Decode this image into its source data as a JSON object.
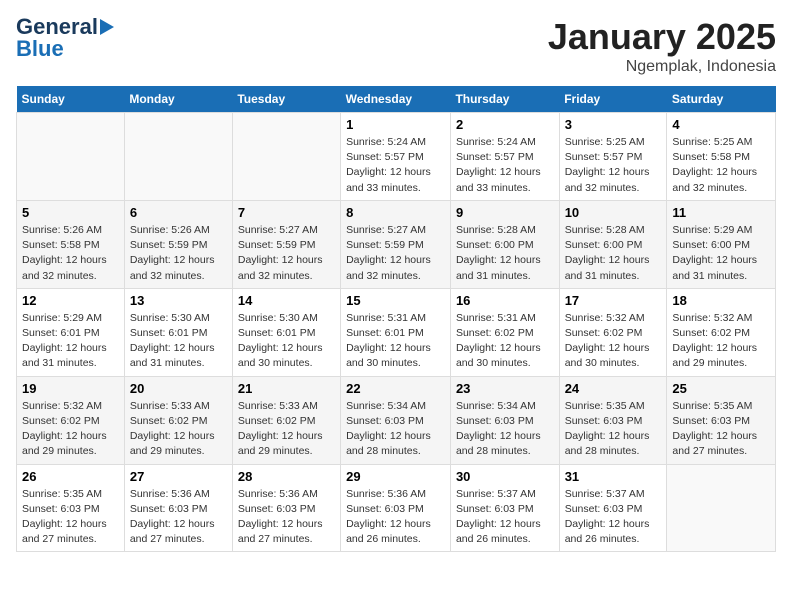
{
  "header": {
    "logo_line1": "General",
    "logo_line2": "Blue",
    "title": "January 2025",
    "subtitle": "Ngemplak, Indonesia"
  },
  "weekdays": [
    "Sunday",
    "Monday",
    "Tuesday",
    "Wednesday",
    "Thursday",
    "Friday",
    "Saturday"
  ],
  "weeks": [
    [
      {
        "day": "",
        "info": ""
      },
      {
        "day": "",
        "info": ""
      },
      {
        "day": "",
        "info": ""
      },
      {
        "day": "1",
        "info": "Sunrise: 5:24 AM\nSunset: 5:57 PM\nDaylight: 12 hours and 33 minutes."
      },
      {
        "day": "2",
        "info": "Sunrise: 5:24 AM\nSunset: 5:57 PM\nDaylight: 12 hours and 33 minutes."
      },
      {
        "day": "3",
        "info": "Sunrise: 5:25 AM\nSunset: 5:57 PM\nDaylight: 12 hours and 32 minutes."
      },
      {
        "day": "4",
        "info": "Sunrise: 5:25 AM\nSunset: 5:58 PM\nDaylight: 12 hours and 32 minutes."
      }
    ],
    [
      {
        "day": "5",
        "info": "Sunrise: 5:26 AM\nSunset: 5:58 PM\nDaylight: 12 hours and 32 minutes."
      },
      {
        "day": "6",
        "info": "Sunrise: 5:26 AM\nSunset: 5:59 PM\nDaylight: 12 hours and 32 minutes."
      },
      {
        "day": "7",
        "info": "Sunrise: 5:27 AM\nSunset: 5:59 PM\nDaylight: 12 hours and 32 minutes."
      },
      {
        "day": "8",
        "info": "Sunrise: 5:27 AM\nSunset: 5:59 PM\nDaylight: 12 hours and 32 minutes."
      },
      {
        "day": "9",
        "info": "Sunrise: 5:28 AM\nSunset: 6:00 PM\nDaylight: 12 hours and 31 minutes."
      },
      {
        "day": "10",
        "info": "Sunrise: 5:28 AM\nSunset: 6:00 PM\nDaylight: 12 hours and 31 minutes."
      },
      {
        "day": "11",
        "info": "Sunrise: 5:29 AM\nSunset: 6:00 PM\nDaylight: 12 hours and 31 minutes."
      }
    ],
    [
      {
        "day": "12",
        "info": "Sunrise: 5:29 AM\nSunset: 6:01 PM\nDaylight: 12 hours and 31 minutes."
      },
      {
        "day": "13",
        "info": "Sunrise: 5:30 AM\nSunset: 6:01 PM\nDaylight: 12 hours and 31 minutes."
      },
      {
        "day": "14",
        "info": "Sunrise: 5:30 AM\nSunset: 6:01 PM\nDaylight: 12 hours and 30 minutes."
      },
      {
        "day": "15",
        "info": "Sunrise: 5:31 AM\nSunset: 6:01 PM\nDaylight: 12 hours and 30 minutes."
      },
      {
        "day": "16",
        "info": "Sunrise: 5:31 AM\nSunset: 6:02 PM\nDaylight: 12 hours and 30 minutes."
      },
      {
        "day": "17",
        "info": "Sunrise: 5:32 AM\nSunset: 6:02 PM\nDaylight: 12 hours and 30 minutes."
      },
      {
        "day": "18",
        "info": "Sunrise: 5:32 AM\nSunset: 6:02 PM\nDaylight: 12 hours and 29 minutes."
      }
    ],
    [
      {
        "day": "19",
        "info": "Sunrise: 5:32 AM\nSunset: 6:02 PM\nDaylight: 12 hours and 29 minutes."
      },
      {
        "day": "20",
        "info": "Sunrise: 5:33 AM\nSunset: 6:02 PM\nDaylight: 12 hours and 29 minutes."
      },
      {
        "day": "21",
        "info": "Sunrise: 5:33 AM\nSunset: 6:02 PM\nDaylight: 12 hours and 29 minutes."
      },
      {
        "day": "22",
        "info": "Sunrise: 5:34 AM\nSunset: 6:03 PM\nDaylight: 12 hours and 28 minutes."
      },
      {
        "day": "23",
        "info": "Sunrise: 5:34 AM\nSunset: 6:03 PM\nDaylight: 12 hours and 28 minutes."
      },
      {
        "day": "24",
        "info": "Sunrise: 5:35 AM\nSunset: 6:03 PM\nDaylight: 12 hours and 28 minutes."
      },
      {
        "day": "25",
        "info": "Sunrise: 5:35 AM\nSunset: 6:03 PM\nDaylight: 12 hours and 27 minutes."
      }
    ],
    [
      {
        "day": "26",
        "info": "Sunrise: 5:35 AM\nSunset: 6:03 PM\nDaylight: 12 hours and 27 minutes."
      },
      {
        "day": "27",
        "info": "Sunrise: 5:36 AM\nSunset: 6:03 PM\nDaylight: 12 hours and 27 minutes."
      },
      {
        "day": "28",
        "info": "Sunrise: 5:36 AM\nSunset: 6:03 PM\nDaylight: 12 hours and 27 minutes."
      },
      {
        "day": "29",
        "info": "Sunrise: 5:36 AM\nSunset: 6:03 PM\nDaylight: 12 hours and 26 minutes."
      },
      {
        "day": "30",
        "info": "Sunrise: 5:37 AM\nSunset: 6:03 PM\nDaylight: 12 hours and 26 minutes."
      },
      {
        "day": "31",
        "info": "Sunrise: 5:37 AM\nSunset: 6:03 PM\nDaylight: 12 hours and 26 minutes."
      },
      {
        "day": "",
        "info": ""
      }
    ]
  ]
}
